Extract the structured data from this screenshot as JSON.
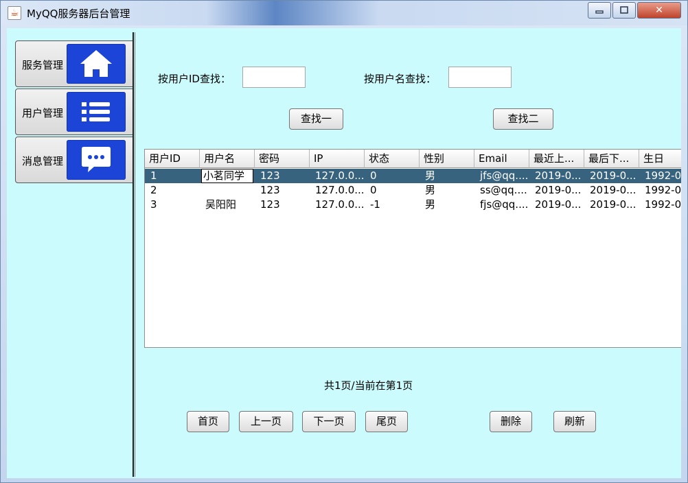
{
  "window": {
    "title": "MyQQ服务器后台管理",
    "app_icon": "java-icon",
    "controls": {
      "minimize": "▭",
      "maximize": "▢",
      "close": "✕"
    }
  },
  "sidebar": {
    "items": [
      {
        "label": "服务管理",
        "icon": "home-icon"
      },
      {
        "label": "用户管理",
        "icon": "list-icon"
      },
      {
        "label": "消息管理",
        "icon": "chat-icon"
      }
    ]
  },
  "search": {
    "by_id_label": "按用户ID查找：",
    "by_id_value": "",
    "by_name_label": "按用户名查找：",
    "by_name_value": "",
    "find1_label": "查找一",
    "find2_label": "查找二"
  },
  "table": {
    "columns": [
      "用户ID",
      "用户名",
      "密码",
      "IP",
      "状态",
      "性别",
      "Email",
      "最近上...",
      "最后下...",
      "生日"
    ],
    "rows": [
      [
        "1",
        "小茗同学",
        "123",
        "127.0.0...",
        "0",
        "男",
        "jfs@qq....",
        "2019-0...",
        "2019-0...",
        "1992-0"
      ],
      [
        "2",
        "",
        "123",
        "127.0.0...",
        "0",
        "男",
        "ss@qq....",
        "2019-0...",
        "2019-0...",
        "1992-0"
      ],
      [
        "3",
        "吴阳阳",
        "123",
        "127.0.0...",
        "-1",
        "男",
        "fjs@qq....",
        "2019-0...",
        "2019-0...",
        "1992-0"
      ]
    ],
    "selected_row": 0
  },
  "pagination": {
    "status": "共1页/当前在第1页",
    "first": "首页",
    "prev": "上一页",
    "next": "下一页",
    "last": "尾页",
    "delete": "删除",
    "refresh": "刷新"
  },
  "colors": {
    "client_bg": "#ccfbfd",
    "tile_blue": "#1c45d8",
    "selected_row": "#38637f"
  }
}
